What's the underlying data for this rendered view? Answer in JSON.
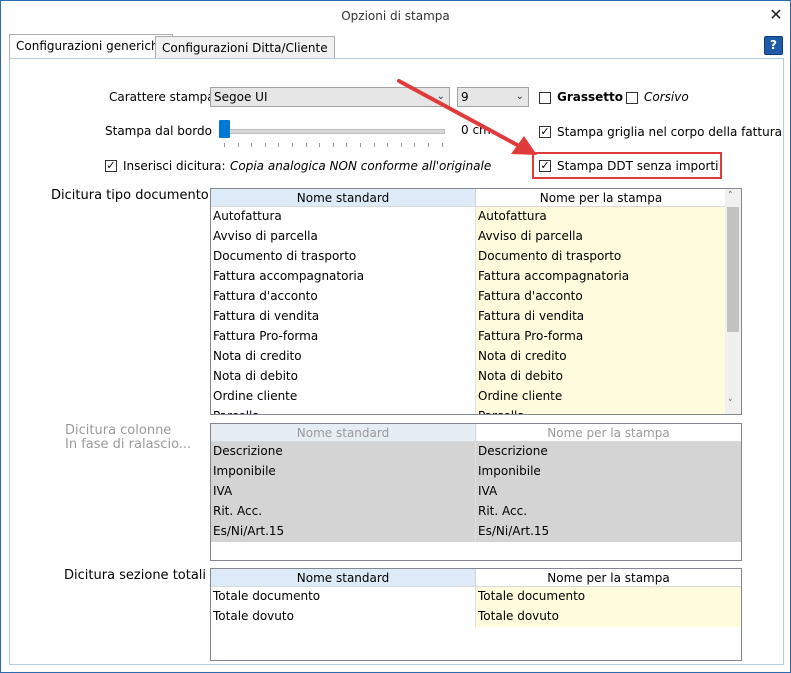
{
  "window": {
    "title": "Opzioni di stampa",
    "close_glyph": "✕",
    "help_glyph": "?"
  },
  "tabs": [
    {
      "label": "Configurazioni generiche",
      "active": true
    },
    {
      "label": "Configurazioni Ditta/Cliente",
      "active": false
    }
  ],
  "font": {
    "label": "Carattere stampa",
    "face_value": "Segoe UI",
    "size_value": "9",
    "bold_label": "Grassetto",
    "bold_checked": false,
    "italic_label": "Corsivo",
    "italic_checked": false
  },
  "margin": {
    "label": "Stampa dal bordo",
    "value_text": "0 cm",
    "level": 0
  },
  "options": {
    "grid_label": "Stampa griglia nel corpo della fattura",
    "grid_checked": true,
    "ddt_label": "Stampa DDT senza importi",
    "ddt_checked": true,
    "dicitura_label": "Inserisci dicitura:",
    "dicitura_checked": true,
    "dicitura_text": "Copia analogica NON conforme all'originale digitale"
  },
  "doc_types": {
    "section_label": "Dicitura tipo documento",
    "col_standard": "Nome standard",
    "col_print": "Nome per la stampa",
    "rows": [
      [
        "Autofattura",
        "Autofattura"
      ],
      [
        "Avviso di parcella",
        "Avviso di parcella"
      ],
      [
        "Documento di trasporto",
        "Documento di trasporto"
      ],
      [
        "Fattura accompagnatoria",
        "Fattura accompagnatoria"
      ],
      [
        "Fattura d'acconto",
        "Fattura d'acconto"
      ],
      [
        "Fattura di vendita",
        "Fattura di vendita"
      ],
      [
        "Fattura Pro-forma",
        "Fattura Pro-forma"
      ],
      [
        "Nota di credito",
        "Nota di credito"
      ],
      [
        "Nota di debito",
        "Nota di debito"
      ],
      [
        "Ordine cliente",
        "Ordine cliente"
      ],
      [
        "Parcella",
        "Parcella"
      ]
    ]
  },
  "columns": {
    "section_label_1": "Dicitura colonne",
    "section_label_2": "In fase di ralascio...",
    "col_standard": "Nome standard",
    "col_print": "Nome per la stampa",
    "rows": [
      [
        "Descrizione",
        "Descrizione"
      ],
      [
        "Imponibile",
        "Imponibile"
      ],
      [
        "IVA",
        "IVA"
      ],
      [
        "Rit. Acc.",
        "Rit. Acc."
      ],
      [
        "Es/Ni/Art.15",
        "Es/Ni/Art.15"
      ]
    ]
  },
  "totals": {
    "section_label": "Dicitura sezione totali",
    "col_standard": "Nome standard",
    "col_print": "Nome per la stampa",
    "rows": [
      [
        "Totale documento",
        "Totale documento"
      ],
      [
        "Totale dovuto",
        "Totale dovuto"
      ]
    ]
  },
  "colors": {
    "header_blue": "#dcebf7",
    "cell_yellow": "#fffbdc",
    "disabled_gray": "#d4d4d4",
    "highlight_red": "#e03a3a"
  }
}
